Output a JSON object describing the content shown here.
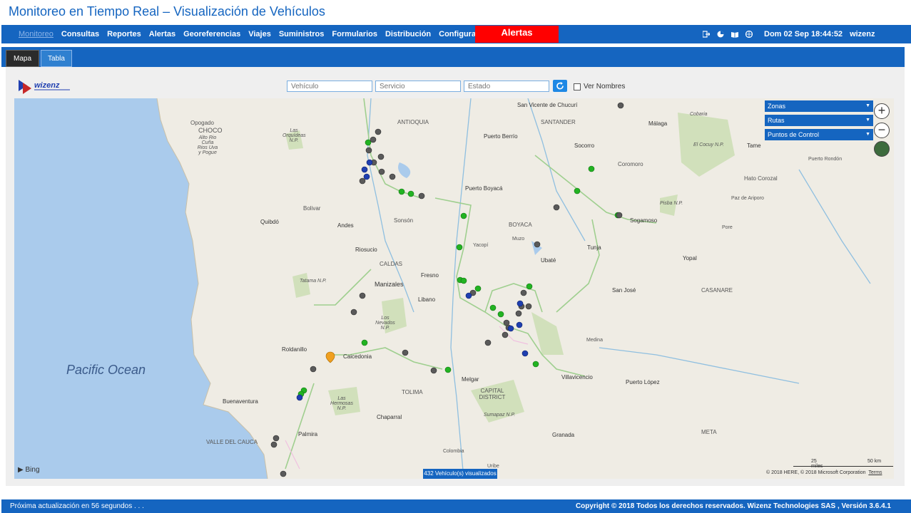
{
  "app": {
    "title": "Monitoreo en Tiempo Real – Visualización de Vehículos"
  },
  "nav": {
    "items": [
      "Monitoreo",
      "Consultas",
      "Reportes",
      "Alertas",
      "Georeferencias",
      "Viajes",
      "Suministros",
      "Formularios",
      "Distribución",
      "Configuración"
    ],
    "alert_label": "Alertas",
    "datetime": "Dom 02 Sep 18:44:52",
    "user": "wizenz",
    "icons": [
      "exit-icon",
      "pie-chart-icon",
      "book-icon",
      "globe-icon"
    ]
  },
  "tabs": [
    "Mapa",
    "Tabla"
  ],
  "filters": {
    "vehiculo_placeholder": "Vehículo",
    "servicio_placeholder": "Servicio",
    "estado_placeholder": "Estado",
    "ver_nombres": "Ver Nombres"
  },
  "logo": "wizenz",
  "map": {
    "controls": [
      "Zonas",
      "Rutas",
      "Puntos de Control"
    ],
    "ocean_label": "Pacific Ocean",
    "bing": "Bing",
    "vehicle_count": "432 Vehículo(s) visualizados",
    "scale_miles": "25 miles",
    "scale_km": "50 km",
    "copyright": "© 2018 HERE, © 2018 Microsoft Corporation",
    "terms": "Terms",
    "labels": [
      "Opogado",
      "CHOCO",
      "Alto Rio Cuña Rios Uva y Pogue",
      "ANTIOQUIA",
      "San Vicente de Chucurí",
      "SANTANDER",
      "Cobaria",
      "Málaga",
      "El Cocuy N.P.",
      "Tame",
      "Puerto Rondón",
      "Puerto Berrío",
      "Socorro",
      "Coromoro",
      "Hato Corozal",
      "Puerto Boyacá",
      "Bolivar",
      "Quibdó",
      "Andes",
      "Sonsón",
      "BOYACA",
      "Sogamoso",
      "Paz de Ariporo",
      "Yacopí",
      "Muzo",
      "Tunja",
      "Pore",
      "Riosucio",
      "CALDAS",
      "Ubaté",
      "Yopal",
      "Fresno",
      "Manizales",
      "Libano",
      "San José",
      "CASANARE",
      "Roldanillo",
      "Caicedonia",
      "Medina",
      "Villavicencio",
      "Puerto López",
      "TOLIMA",
      "Melgar",
      "CAPITAL DISTRICT",
      "Buenaventura",
      "Chaparral",
      "Palmira",
      "VALLE DEL CAUCA",
      "Granada",
      "Colombia",
      "Uribe",
      "META",
      "Los Nevados N.P.",
      "Las Hermosas N.P.",
      "Sumapaz N.P.",
      "Tatama N.P.",
      "Pisba N.P.",
      "Las Orquídeas N.P."
    ]
  },
  "footer": {
    "next_update": "Próxima actualización en 56 segundos . . .",
    "copyright": "Copyright © 2018 Todos los derechos reservados. Wizenz Technologies SAS , Versión 3.6.4.1"
  },
  "colors": {
    "primary": "#1565c0",
    "alert": "#ff0000",
    "marker_green": "#22b322",
    "marker_gray": "#555555",
    "marker_blue": "#1f3fb0",
    "marker_orange": "#f0a020"
  }
}
